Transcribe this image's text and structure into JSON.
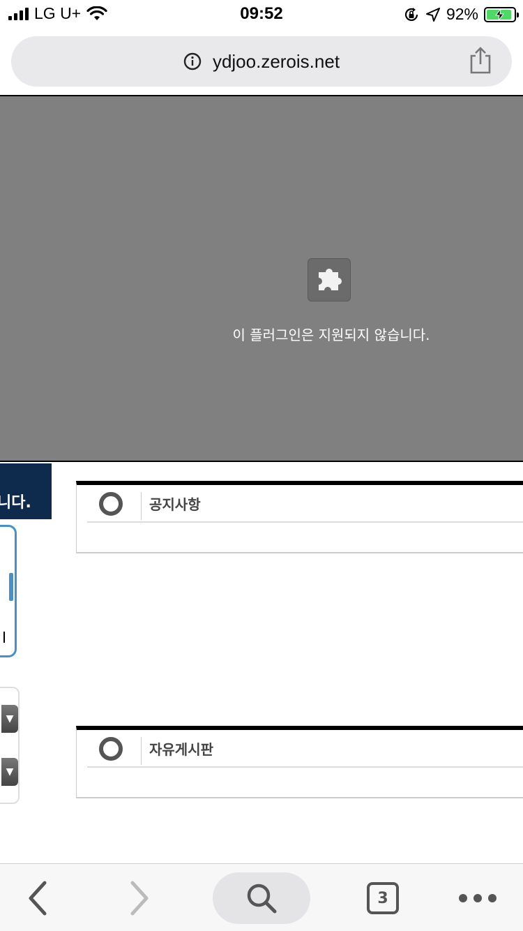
{
  "status_bar": {
    "carrier": "LG U+",
    "time": "09:52",
    "battery_percent": "92%",
    "battery_level": 0.92,
    "icons": [
      "signal-icon",
      "wifi-icon",
      "orientation-lock-icon",
      "location-icon",
      "battery-charging-icon"
    ]
  },
  "browser": {
    "url": "ydjoo.zerois.net",
    "tab_count": "3"
  },
  "plugin": {
    "message": "이 플러그인은 지원되지 않습니다.",
    "icon": "puzzle-icon"
  },
  "left_fragment": {
    "banner_text": "니다."
  },
  "boards": [
    {
      "title": "공지사항"
    },
    {
      "title": "자유게시판"
    }
  ],
  "colors": {
    "plugin_bg": "#808080",
    "banner_bg": "#0e2b4e",
    "panel_border": "#4a90c8",
    "battery_fill": "#4cd964"
  }
}
